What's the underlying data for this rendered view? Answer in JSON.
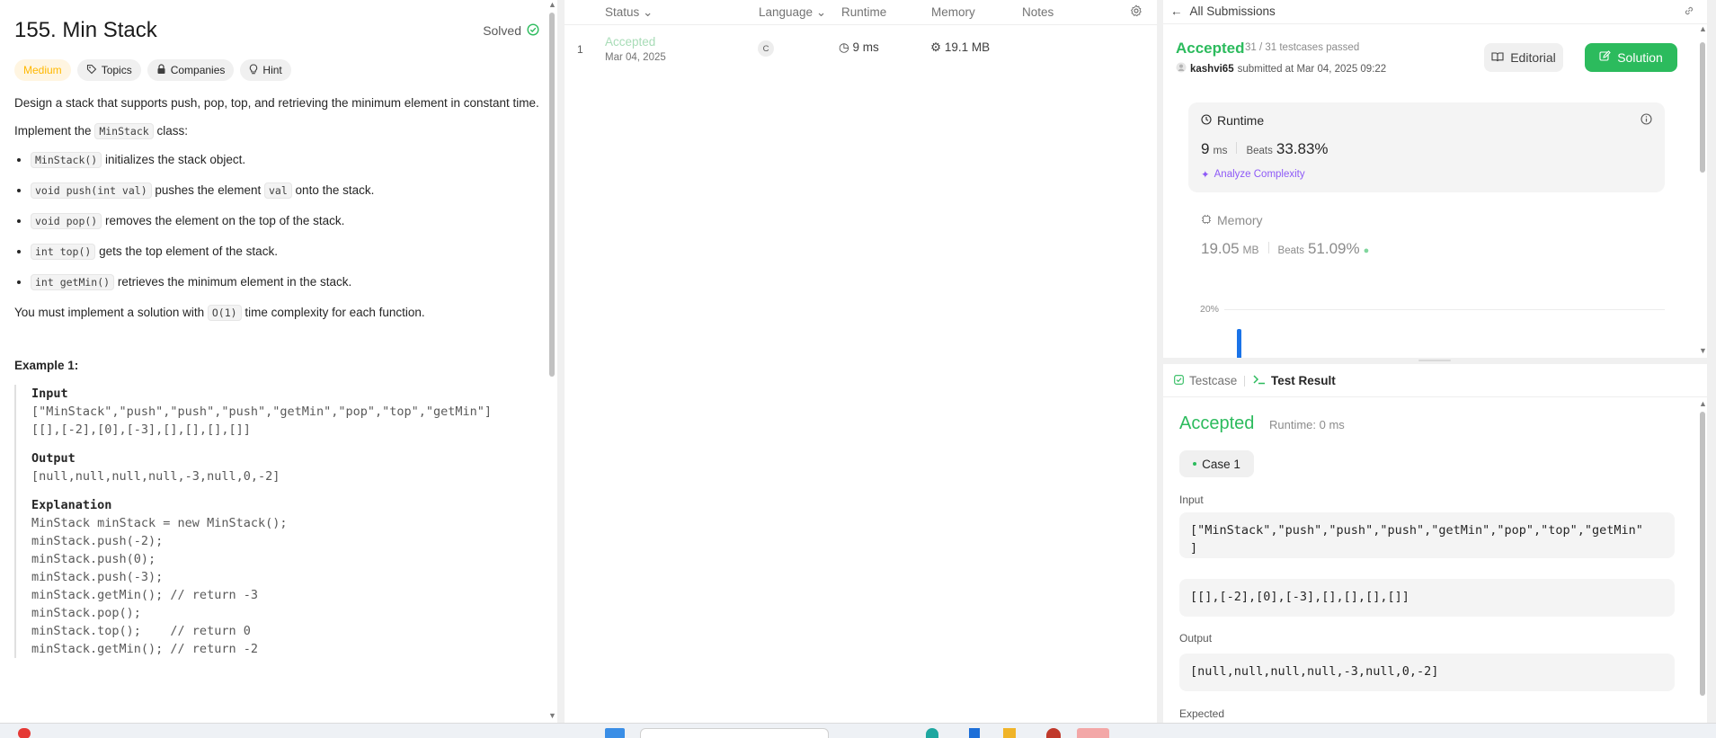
{
  "problem": {
    "title": "155. Min Stack",
    "solved_label": "Solved",
    "tags": {
      "difficulty": "Medium",
      "topics": "Topics",
      "companies": "Companies",
      "hint": "Hint"
    },
    "description_1": "Design a stack that supports push, pop, top, and retrieving the minimum element in constant time.",
    "implement_prefix": "Implement the",
    "implement_code": "MinStack",
    "implement_suffix": "class:",
    "methods": [
      {
        "code": "MinStack()",
        "text": "initializes the stack object."
      },
      {
        "code": "void push(int val)",
        "text_a": "pushes the element",
        "code2": "val",
        "text_b": "onto the stack."
      },
      {
        "code": "void pop()",
        "text": "removes the element on the top of the stack."
      },
      {
        "code": "int top()",
        "text": "gets the top element of the stack."
      },
      {
        "code": "int getMin()",
        "text": "retrieves the minimum element in the stack."
      }
    ],
    "complexity_prefix": "You must implement a solution with",
    "complexity_code": "O(1)",
    "complexity_suffix": "time complexity for each function.",
    "example_title": "Example 1:",
    "example": {
      "input_label": "Input",
      "input_line1": "[\"MinStack\",\"push\",\"push\",\"push\",\"getMin\",\"pop\",\"top\",\"getMin\"]",
      "input_line2": "[[],[-2],[0],[-3],[],[],[],[]]",
      "output_label": "Output",
      "output_line": "[null,null,null,null,-3,null,0,-2]",
      "explanation_label": "Explanation",
      "explanation_lines": [
        "MinStack minStack = new MinStack();",
        "minStack.push(-2);",
        "minStack.push(0);",
        "minStack.push(-3);",
        "minStack.getMin(); // return -3",
        "minStack.pop();",
        "minStack.top();    // return 0",
        "minStack.getMin(); // return -2"
      ]
    }
  },
  "submissions": {
    "columns": {
      "status": "Status",
      "language": "Language",
      "runtime": "Runtime",
      "memory": "Memory",
      "notes": "Notes"
    },
    "rows": [
      {
        "index": "1",
        "status": "Accepted",
        "date": "Mar 04, 2025",
        "language": "C",
        "runtime": "9 ms",
        "memory": "19.1 MB"
      }
    ]
  },
  "detail": {
    "back_label": "All Submissions",
    "status": "Accepted",
    "testcases": "31 / 31 testcases passed",
    "user": "kashvi65",
    "submitted_text": "submitted at Mar 04, 2025 09:22",
    "editorial_label": "Editorial",
    "solution_label": "Solution",
    "runtime_title": "Runtime",
    "runtime_value": "9",
    "runtime_unit": "ms",
    "beats_label": "Beats",
    "runtime_beats": "33.83%",
    "analyze_label": "Analyze Complexity",
    "memory_title": "Memory",
    "memory_value": "19.05",
    "memory_unit": "MB",
    "memory_beats": "51.09%",
    "axis_label": "20%"
  },
  "test_result": {
    "tab_testcase": "Testcase",
    "tab_result": "Test Result",
    "status": "Accepted",
    "runtime": "Runtime: 0 ms",
    "case_label": "Case 1",
    "input_label": "Input",
    "input_line1": "[\"MinStack\",\"push\",\"push\",\"push\",\"getMin\",\"pop\",\"top\",\"getMin\"",
    "input_line1b": "]",
    "input_line2": "[[],[-2],[0],[-3],[],[],[],[]]",
    "output_label": "Output",
    "output_line": "[null,null,null,null,-3,null,0,-2]",
    "expected_label": "Expected"
  },
  "colors": {
    "accent_green": "#2cbb5d",
    "medium": "#ffb800",
    "analyze_purple": "#8e5af7",
    "bar_blue": "#1a73e8"
  }
}
